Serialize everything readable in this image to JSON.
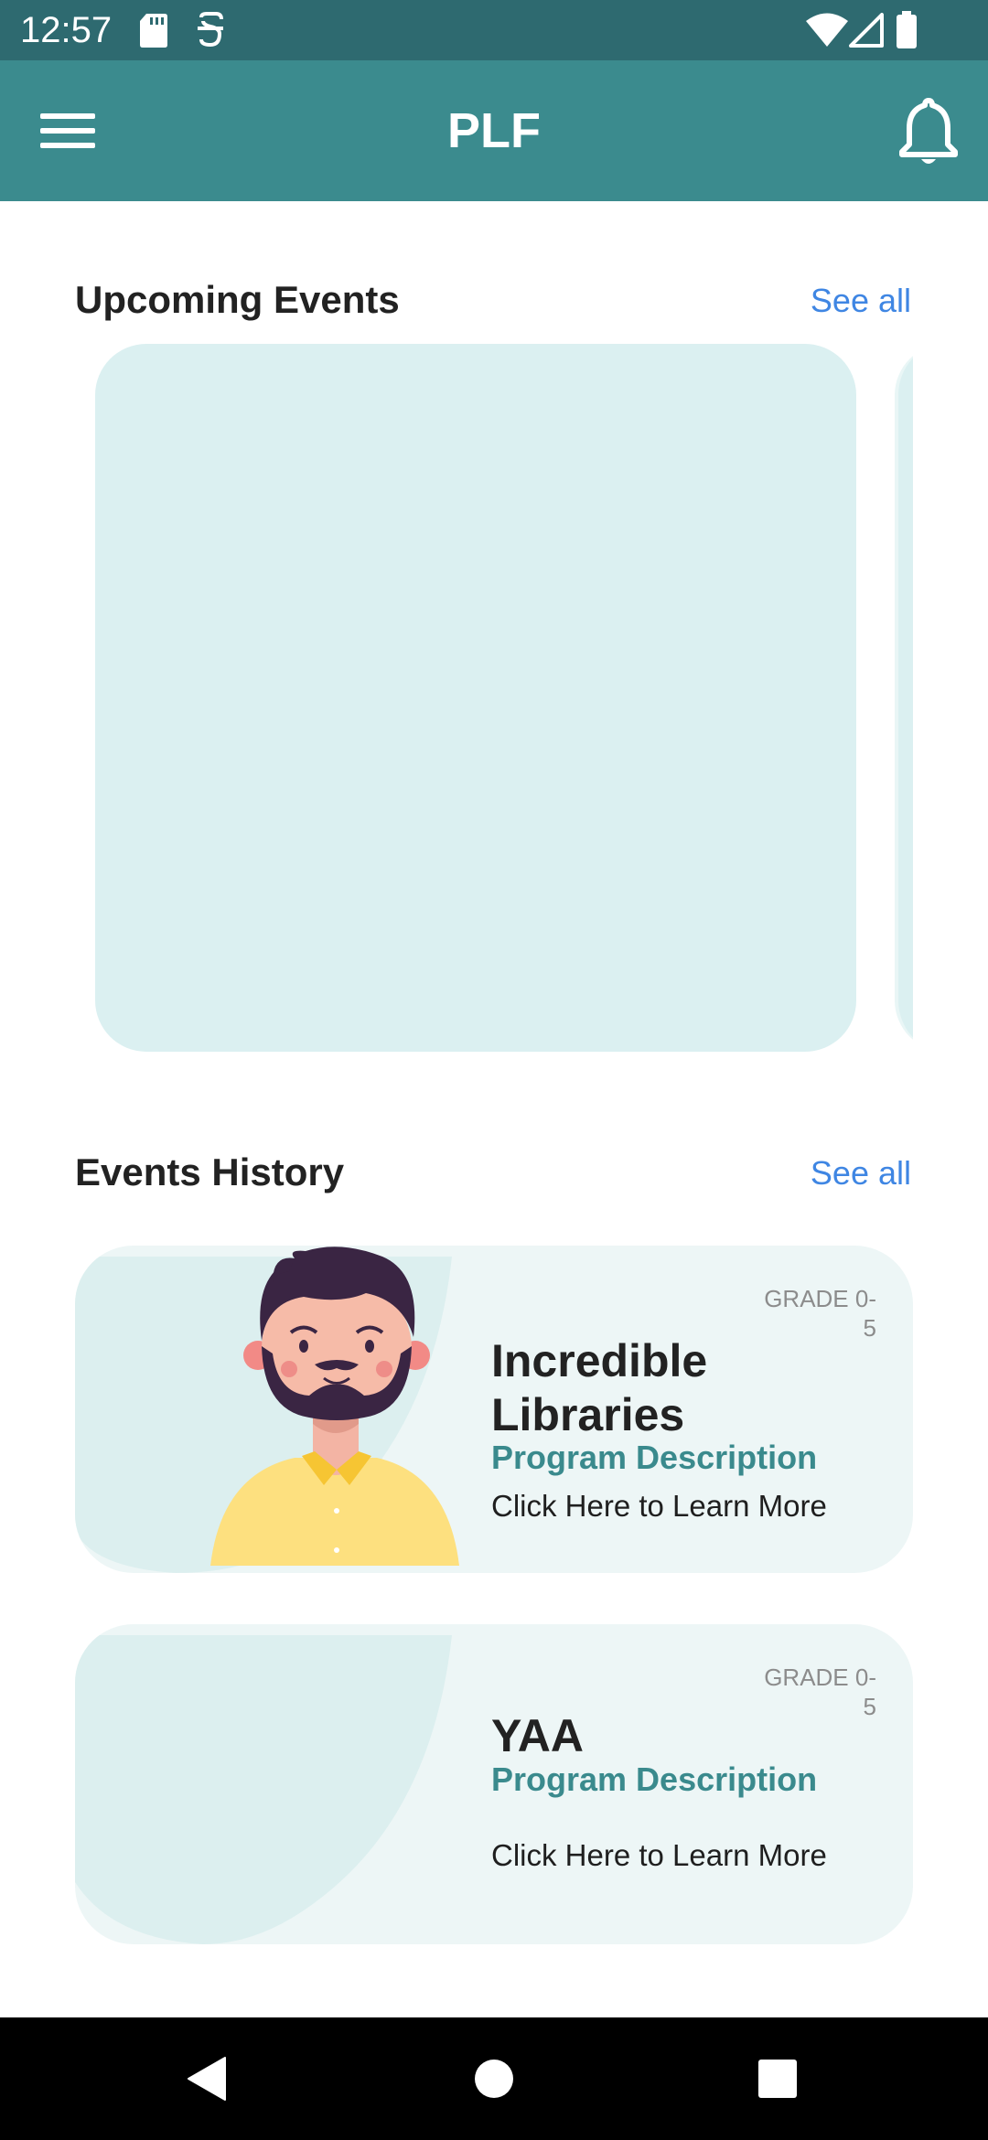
{
  "status_bar": {
    "time": "12:57",
    "left_icons": [
      "sd-card-icon",
      "sim-card-icon"
    ],
    "right_icons": [
      "wifi-icon",
      "cell-signal-icon",
      "battery-icon"
    ]
  },
  "app_bar": {
    "title": "PLF",
    "menu_icon": "hamburger-menu-icon",
    "notification_icon": "bell-icon",
    "color": "#3b8b8e"
  },
  "upcoming_events": {
    "heading": "Upcoming Events",
    "see_all": "See all"
  },
  "events_history": {
    "heading": "Events History",
    "see_all": "See all",
    "items": [
      {
        "grade": "GRADE 0-5",
        "title_line1": "Incredible",
        "title_line2": "Libraries",
        "description": "Program Description",
        "cta": "Click Here to Learn More"
      },
      {
        "grade": "GRADE 0-5",
        "title_line1": "YAA",
        "description": "Program Description",
        "cta": "Click Here to Learn More"
      }
    ]
  },
  "nav_bar": {
    "icons": [
      "back-triangle-icon",
      "home-circle-icon",
      "recents-square-icon"
    ]
  },
  "colors": {
    "accent": "#3b8b8e",
    "link": "#3f86e3",
    "card": "#dbf0f1"
  }
}
